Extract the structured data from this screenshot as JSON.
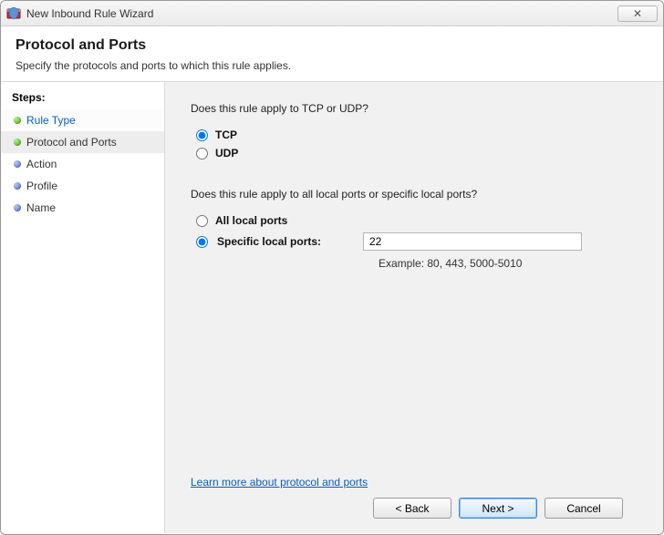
{
  "window": {
    "title": "New Inbound Rule Wizard",
    "close_glyph": "✕"
  },
  "header": {
    "title": "Protocol and Ports",
    "subtitle": "Specify the protocols and ports to which this rule applies."
  },
  "sidebar": {
    "heading": "Steps:",
    "items": [
      {
        "label": "Rule Type",
        "bullet": "green",
        "current": true
      },
      {
        "label": "Protocol and Ports",
        "bullet": "green",
        "active": true
      },
      {
        "label": "Action",
        "bullet": "blue"
      },
      {
        "label": "Profile",
        "bullet": "blue"
      },
      {
        "label": "Name",
        "bullet": "blue"
      }
    ]
  },
  "main": {
    "protocol_question": "Does this rule apply to TCP or UDP?",
    "protocol_options": {
      "tcp": "TCP",
      "udp": "UDP",
      "selected": "tcp"
    },
    "port_question": "Does this rule apply to all local ports or specific local ports?",
    "port_options": {
      "all": "All local ports",
      "specific": "Specific local ports:",
      "selected": "specific",
      "value": "22",
      "example": "Example: 80, 443, 5000-5010"
    },
    "learn_more": "Learn more about protocol and ports"
  },
  "buttons": {
    "back": "< Back",
    "next": "Next >",
    "cancel": "Cancel"
  }
}
